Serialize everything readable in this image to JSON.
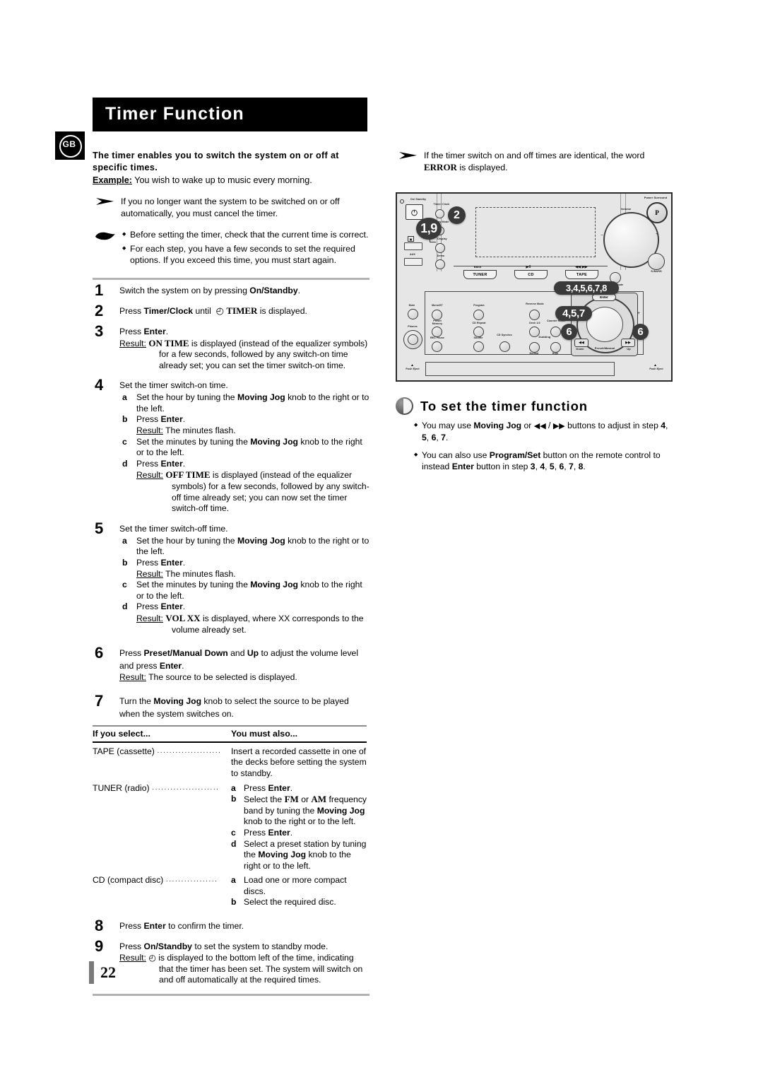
{
  "page": {
    "title": "Timer Function",
    "locale_badge": "GB",
    "number": "22"
  },
  "intro": {
    "bold": "The timer enables you to switch the system on or off at specific times.",
    "example_label": "Example:",
    "example_text": "You wish to wake up to music every morning.",
    "arrow_note": "If you no longer want the system to be switched on or off automatically, you must cancel the timer.",
    "hand_notes": [
      "Before setting the timer, check that the current time is correct.",
      "For each step, you have a few seconds to set the required options. If you exceed this time, you must start again."
    ]
  },
  "right_note": {
    "text_before": "If the timer switch on and off times are identical, the word ",
    "emphasis": "ERROR",
    "text_after": " is displayed."
  },
  "steps": [
    {
      "n": "1",
      "text_parts": [
        "Switch the system on by pressing ",
        "On/Standby",
        "."
      ]
    },
    {
      "n": "2",
      "text_parts": [
        "Press ",
        "Timer/Clock",
        " until ",
        "◴",
        " TIMER is displayed."
      ]
    },
    {
      "n": "3",
      "text_parts": [
        "Press ",
        "Enter",
        "."
      ],
      "result_label": "Result:",
      "result_text": "ON TIME is displayed (instead of the equalizer symbols) for a few seconds, followed by any switch-on time already set; you can set the timer switch-on time.",
      "result_lead": "ON TIME",
      "result_rest": " is displayed (instead of the equalizer symbols) for a few seconds, followed by any switch-on time already set; you can set the timer switch-on time."
    },
    {
      "n": "4",
      "text": "Set the timer switch-on time.",
      "subs": [
        {
          "a": "a",
          "parts": [
            "Set the hour by tuning the ",
            "Moving Jog",
            " knob to the right or to the left."
          ]
        },
        {
          "a": "b",
          "parts": [
            "Press ",
            "Enter",
            "."
          ],
          "result_label": "Result:",
          "result_text": "The minutes flash."
        },
        {
          "a": "c",
          "parts": [
            "Set the minutes by tuning the ",
            "Moving Jog",
            " knob to the right or to the left."
          ]
        },
        {
          "a": "d",
          "parts": [
            "Press ",
            "Enter",
            "."
          ],
          "result_label": "Result:",
          "result_lead": "OFF TIME",
          "result_rest": " is displayed (instead of the equalizer symbols) for a few seconds, followed by any switch-off time already set; you can now set the timer switch-off time."
        }
      ]
    },
    {
      "n": "5",
      "text": "Set the timer switch-off time.",
      "subs": [
        {
          "a": "a",
          "parts": [
            "Set the hour by tuning the ",
            "Moving Jog",
            " knob to the right or to the left."
          ]
        },
        {
          "a": "b",
          "parts": [
            "Press ",
            "Enter",
            "."
          ],
          "result_label": "Result:",
          "result_text": "The minutes flash."
        },
        {
          "a": "c",
          "parts": [
            "Set the minutes by tuning the ",
            "Moving Jog",
            " knob to the right or to the left."
          ]
        },
        {
          "a": "d",
          "parts": [
            "Press ",
            "Enter",
            "."
          ],
          "result_label": "Result:",
          "result_lead": "VOL XX",
          "result_rest": " is displayed, where XX corresponds to the volume already set."
        }
      ]
    },
    {
      "n": "6",
      "text_parts": [
        "Press ",
        "Preset/Manual Down",
        " and ",
        "Up",
        " to adjust the volume level and press ",
        "Enter",
        "."
      ],
      "result_label": "Result:",
      "result_text": "The source to be selected is displayed."
    },
    {
      "n": "7",
      "text_parts": [
        "Turn the ",
        "Moving Jog",
        " knob to select the source to be played when the system switches on."
      ]
    },
    {
      "n": "8",
      "text_parts": [
        "Press ",
        "Enter",
        " to confirm the timer."
      ]
    },
    {
      "n": "9",
      "text_parts": [
        "Press ",
        "On/Standby",
        " to set the system to standby mode."
      ],
      "result_label": "Result:",
      "result_icon": "◴",
      "result_text": " is displayed to the bottom left of the time, indicating that the timer has been set. The system will switch on and off automatically at the required times."
    }
  ],
  "select_table": {
    "headers": [
      "If you select...",
      "You must also..."
    ],
    "rows": [
      {
        "left": "TAPE (cassette)",
        "right_plain": "Insert a recorded cassette in one of the decks before setting the system to standby."
      },
      {
        "left": "TUNER (radio)",
        "right_items": [
          {
            "a": "a",
            "parts": [
              "Press ",
              "Enter",
              "."
            ]
          },
          {
            "a": "b",
            "parts": [
              "Select the ",
              "FM",
              " or ",
              "AM",
              " frequency band by tuning the ",
              "Moving Jog",
              " knob to the right or to the left."
            ]
          },
          {
            "a": "c",
            "parts": [
              "Press ",
              "Enter",
              "."
            ]
          },
          {
            "a": "d",
            "parts": [
              "Select a preset station by tuning the ",
              "Moving Jog",
              " knob to the right or to the left."
            ]
          }
        ]
      },
      {
        "left": "CD (compact disc)",
        "right_items": [
          {
            "a": "a",
            "parts": [
              "Load one or more compact discs."
            ]
          },
          {
            "a": "b",
            "parts": [
              "Select the required disc."
            ]
          }
        ]
      }
    ]
  },
  "section": {
    "title": "To set the timer function",
    "bullets": [
      {
        "parts": [
          "You may use ",
          "Moving Jog",
          " or ",
          "◀◀",
          " / ",
          "▶▶",
          " buttons to adjust in step ",
          "4, 5, 6, 7",
          "."
        ]
      },
      {
        "parts": [
          "You can also use ",
          "Program/Set",
          " button on the remote control to instead ",
          "Enter",
          " button in step ",
          "3, 4, 5, 6, 7, 8",
          "."
        ]
      }
    ]
  },
  "illustration": {
    "callouts": [
      {
        "id": "c19",
        "label": "1,9"
      },
      {
        "id": "c2",
        "label": "2"
      },
      {
        "id": "c345678",
        "label": "3,4,5,6,7,8"
      },
      {
        "id": "c457",
        "label": "4,5,7"
      },
      {
        "id": "c6left",
        "label": "6"
      },
      {
        "id": "c6right",
        "label": "6"
      }
    ],
    "labels": {
      "on_standby": "On/ Standby",
      "timer_clock": "Timer/ Clock",
      "play_mode": "Play Mode",
      "kit": "KIT",
      "display": "Display",
      "demo": "Demo",
      "aux": "AUX",
      "mute": "Mute",
      "phones": "Phones",
      "mono_st": "Mono/ST",
      "preset_memory": "Preset Memory",
      "rec_pause": "REC Pause",
      "program": "Program",
      "cd_repeat": "CD Repeat",
      "shuffle": "Shuffle",
      "cd_synchro": "CD Synchro",
      "reverse_mode": "Reverse Mode",
      "deck": "Deck 1/2",
      "counter_reset": "Counter Reset",
      "dubbing": "Dubbing",
      "normal": "Normal",
      "high": "High",
      "band": "Band",
      "tuner": "TUNER",
      "cd": "CD",
      "tape": "TAPE",
      "play_pause": "▶II",
      "rew_ff": "◀◀ ▶▶",
      "volume": "Volume",
      "power_surround": "Power Surround",
      "power_surround_mark": "P",
      "s_bass": "S.BASS",
      "sound_mode": "Sound Mode",
      "enter": "Enter",
      "preset_manual": "Preset/Manual",
      "down": "Down",
      "up": "Up",
      "push_eject_left": "Push Eject",
      "push_eject_right": "Push Eject",
      "plus": "+",
      "minus": "−",
      "power_glyph": "⏻"
    }
  }
}
